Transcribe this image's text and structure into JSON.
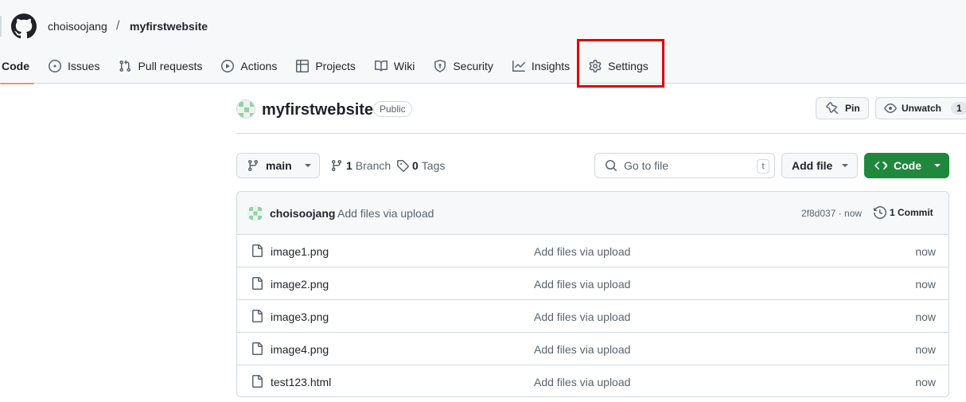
{
  "breadcrumb": {
    "owner": "choisoojang",
    "separator": "/",
    "repo": "myfirstwebsite"
  },
  "tabs": [
    {
      "label": "Code",
      "icon": "code-icon",
      "selected": true
    },
    {
      "label": "Issues",
      "icon": "issue-opened-icon"
    },
    {
      "label": "Pull requests",
      "icon": "git-pull-request-icon"
    },
    {
      "label": "Actions",
      "icon": "play-icon"
    },
    {
      "label": "Projects",
      "icon": "table-icon"
    },
    {
      "label": "Wiki",
      "icon": "book-icon"
    },
    {
      "label": "Security",
      "icon": "shield-icon"
    },
    {
      "label": "Insights",
      "icon": "graph-icon"
    },
    {
      "label": "Settings",
      "icon": "gear-icon",
      "highlighted": true
    }
  ],
  "highlight_color": "#e00000",
  "repo": {
    "name": "myfirstwebsite",
    "visibility": "Public",
    "pin_label": "Pin",
    "watch_label": "Unwatch",
    "watch_count": "1"
  },
  "toolbar": {
    "branch": "main",
    "branch_count": "1",
    "branch_label": "Branch",
    "tag_count": "0",
    "tag_label": "Tags",
    "search_placeholder": "Go to file",
    "search_shortcut": "t",
    "add_file_label": "Add file",
    "code_label": "Code"
  },
  "latest_commit": {
    "author": "choisoojang",
    "message": "Add files via upload",
    "sha_time": "2f8d037 · now",
    "commit_count": "1 Commit"
  },
  "files": [
    {
      "name": "image1.png",
      "message": "Add files via upload",
      "time": "now"
    },
    {
      "name": "image2.png",
      "message": "Add files via upload",
      "time": "now"
    },
    {
      "name": "image3.png",
      "message": "Add files via upload",
      "time": "now"
    },
    {
      "name": "image4.png",
      "message": "Add files via upload",
      "time": "now"
    },
    {
      "name": "test123.html",
      "message": "Add files via upload",
      "time": "now"
    }
  ],
  "colors": {
    "primary_button": "#1f883d",
    "tab_underline": "#fd8c73",
    "header_bg": "#f6f8fa"
  }
}
